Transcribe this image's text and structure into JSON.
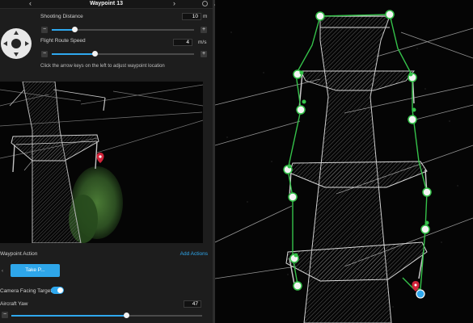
{
  "header": {
    "title": "Waypoint 13",
    "prev_symbol": "‹",
    "next_symbol": "›"
  },
  "shooting_distance": {
    "label": "Shooting Distance",
    "value": "10",
    "unit": "m",
    "fraction": 0.16
  },
  "flight_route_speed": {
    "label": "Flight Route Speed",
    "value": "4",
    "unit": "m/s",
    "fraction": 0.3
  },
  "stepper": {
    "minus": "−",
    "plus": "+"
  },
  "hint": "Click the arrow keys on the left to adjust waypoint location",
  "waypoint_action": {
    "label": "Waypoint Action",
    "add_label": "Add Actions",
    "action_button": "Take P..."
  },
  "camera_facing_target": {
    "label": "Camera Facing Target",
    "enabled": true
  },
  "aircraft_yaw": {
    "label": "Aircraft Yaw",
    "value": "47",
    "fraction": 0.6
  },
  "colors": {
    "accent": "#2fa8ee",
    "route": "#35c24a",
    "marker": "#d0243a",
    "selected": "#2fa8ee"
  }
}
